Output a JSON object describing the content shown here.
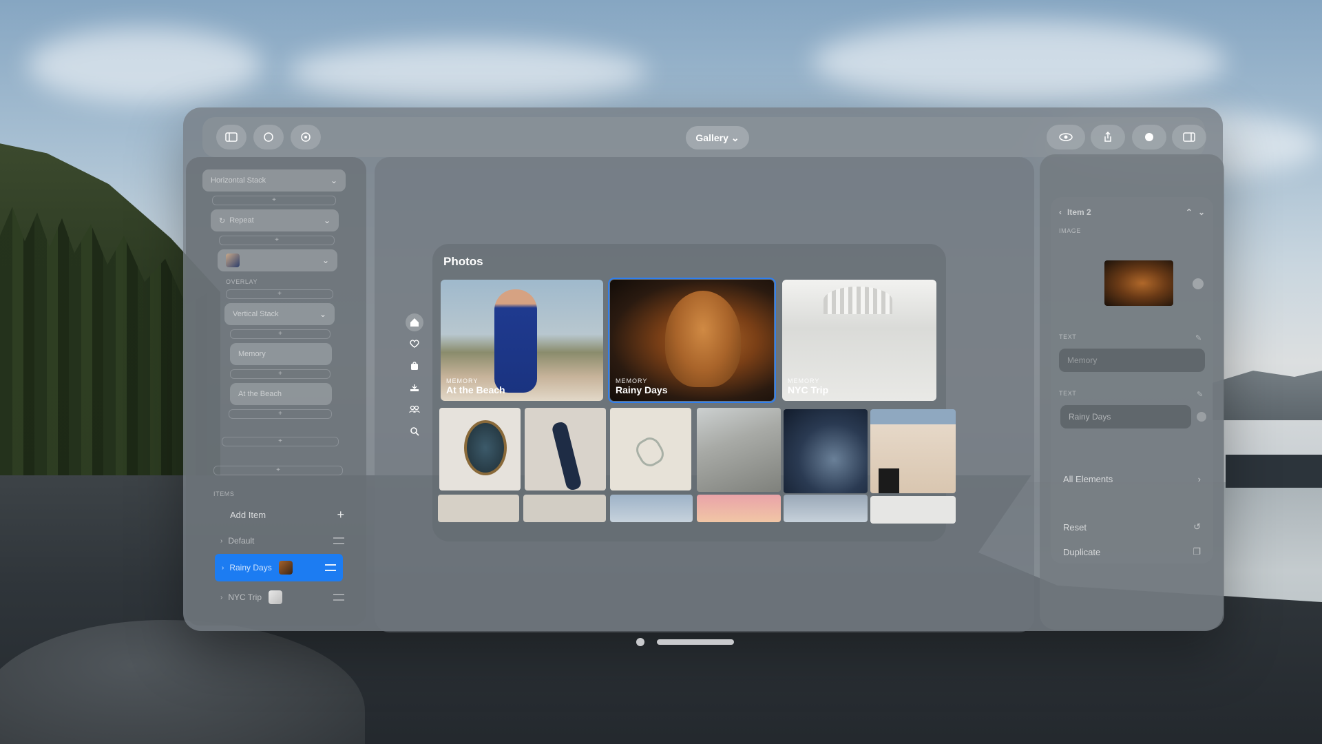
{
  "toolbar": {
    "left_icons": [
      "sidebar-icon",
      "toggle-icon",
      "settings-icon"
    ],
    "center_menu": "Gallery",
    "right_icons": [
      "eye-icon",
      "share-icon",
      "record-icon",
      "window-icon"
    ]
  },
  "sidebar": {
    "stack_type": "Horizontal Stack",
    "repeat": "Repeat",
    "overlay_caption": "OVERLAY",
    "overlay_stack": "Vertical Stack",
    "fields": [
      "Memory",
      "At the Beach"
    ],
    "items_caption": "ITEMS",
    "add_item": "Add Item",
    "items": [
      {
        "label": "Default"
      },
      {
        "label": "Rainy Days"
      },
      {
        "label": "NYC Trip"
      }
    ]
  },
  "photos": {
    "title": "Photos",
    "memories": [
      {
        "kicker": "MEMORY",
        "title": "At the Beach"
      },
      {
        "kicker": "MEMORY",
        "title": "Rainy Days"
      },
      {
        "kicker": "MEMORY",
        "title": "NYC Trip"
      }
    ],
    "tabs": [
      "home-icon",
      "heart-icon",
      "bag-icon",
      "inbox-icon",
      "people-icon",
      "search-icon"
    ]
  },
  "inspector": {
    "header": "Item 2",
    "image_caption": "IMAGE",
    "text_caption_1": "TEXT",
    "text_value_1": "Memory",
    "text_caption_2": "TEXT",
    "text_value_2": "Rainy Days",
    "all_elements": "All Elements",
    "reset": "Reset",
    "duplicate": "Duplicate"
  },
  "colors": {
    "accent": "#1c7cf2",
    "selection": "#2f7ff0"
  }
}
